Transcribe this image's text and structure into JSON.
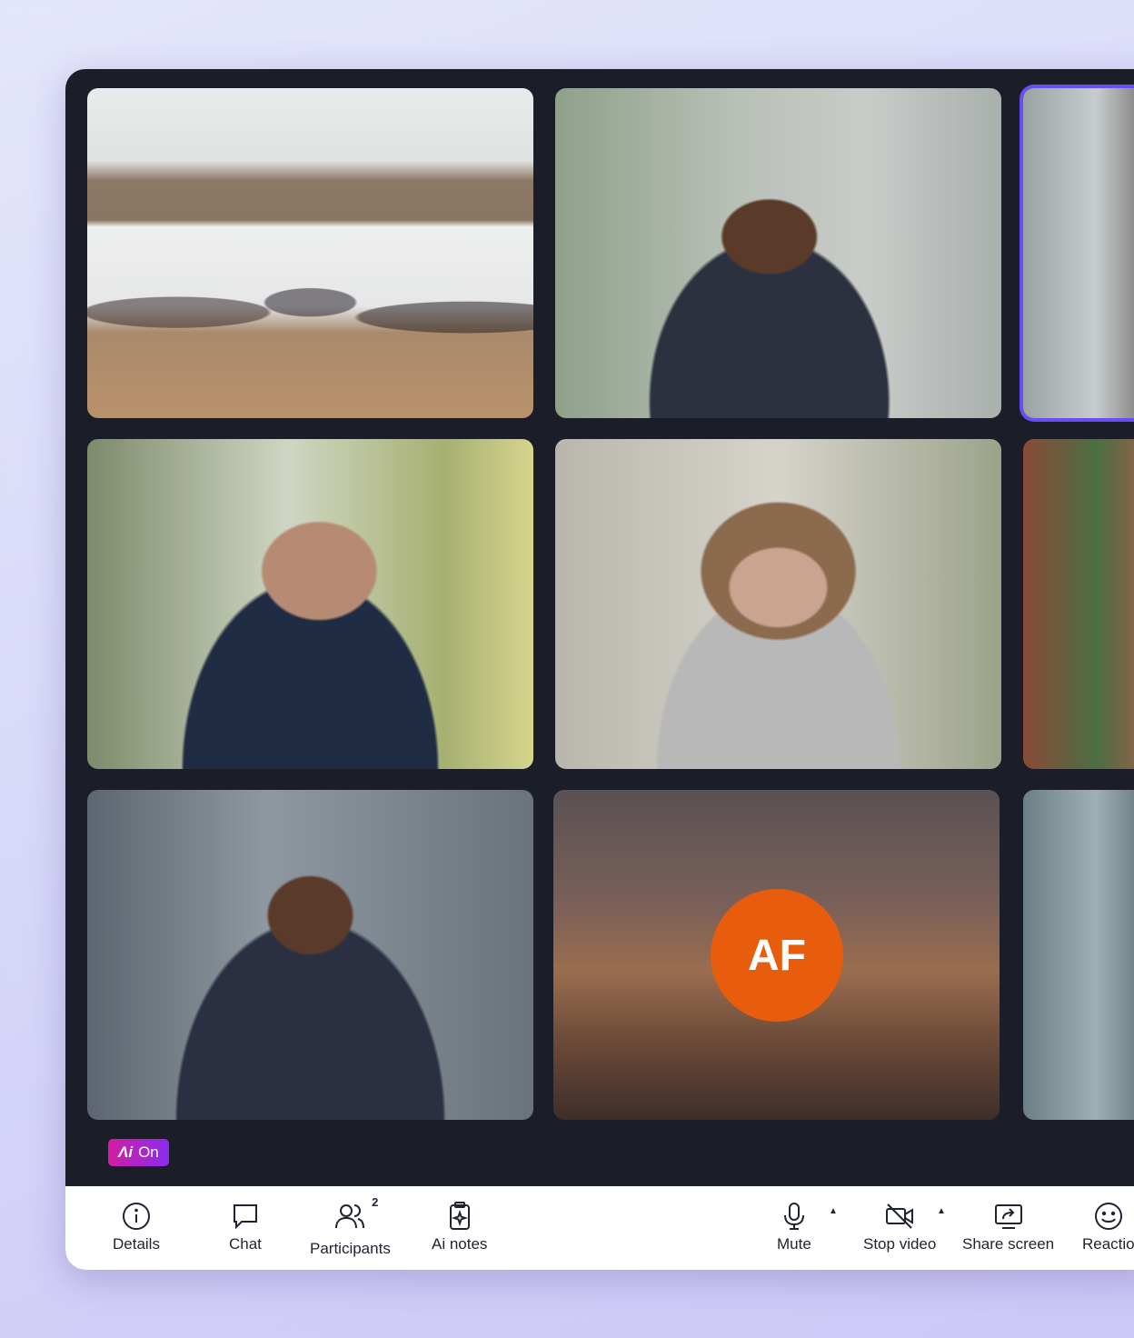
{
  "tiles": {
    "avatar_initials": "AF"
  },
  "ai_status": {
    "label": "On"
  },
  "toolbar": {
    "details_label": "Details",
    "chat_label": "Chat",
    "participants_label": "Participants",
    "participants_count": "2",
    "ai_notes_label": "Ai notes",
    "mute_label": "Mute",
    "stop_video_label": "Stop video",
    "share_screen_label": "Share screen",
    "reactions_label": "Reactio"
  },
  "colors": {
    "avatar_bg": "#e85d0d",
    "speaking_outline": "#6a4df5",
    "ai_badge_gradient_start": "#d21ea0",
    "ai_badge_gradient_end": "#8a2cf0"
  }
}
